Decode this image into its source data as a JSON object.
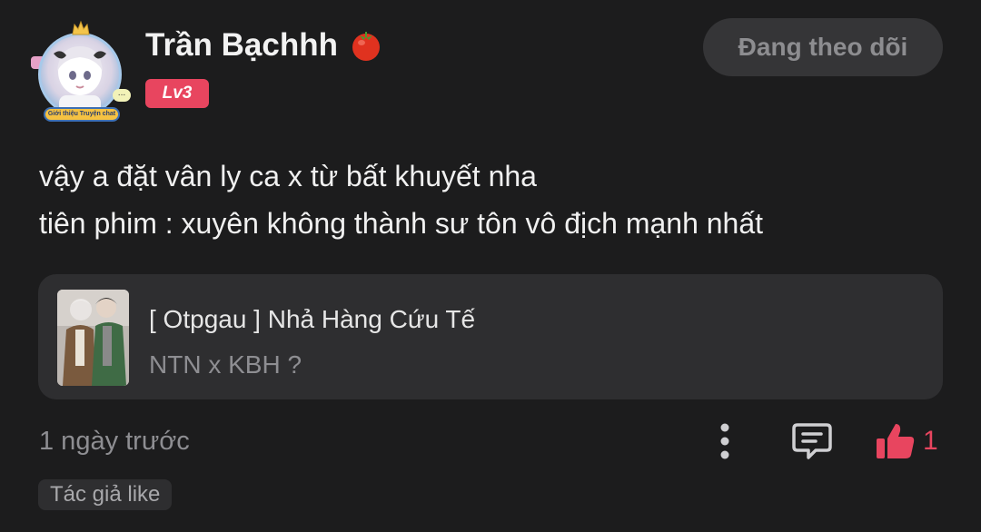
{
  "user": {
    "name": "Trần Bạchhh",
    "level": "Lv3",
    "avatar_banner": "Giới thiệu Truyện chat",
    "avatar_bubble": "..."
  },
  "header": {
    "follow_label": "Đang theo dõi"
  },
  "comment": {
    "lines": [
      "vậy a đặt vân ly ca x từ bất khuyết nha",
      "tiên phim : xuyên không thành sư tôn vô địch mạnh nhất"
    ]
  },
  "book": {
    "title": "[ Otpgau ] Nhả Hàng Cứu Tế",
    "subtitle": "NTN x KBH ?"
  },
  "footer": {
    "timestamp": "1 ngày trước",
    "like_count": "1",
    "author_liked": "Tác giả like"
  },
  "icons": {
    "badge": "tomato-icon",
    "more": "more-vertical-icon",
    "reply": "comment-icon",
    "like": "thumbs-up-icon"
  },
  "colors": {
    "background": "#1c1c1d",
    "accent": "#e8455f",
    "card": "#2e2e30",
    "muted_text": "#8e8e92"
  }
}
